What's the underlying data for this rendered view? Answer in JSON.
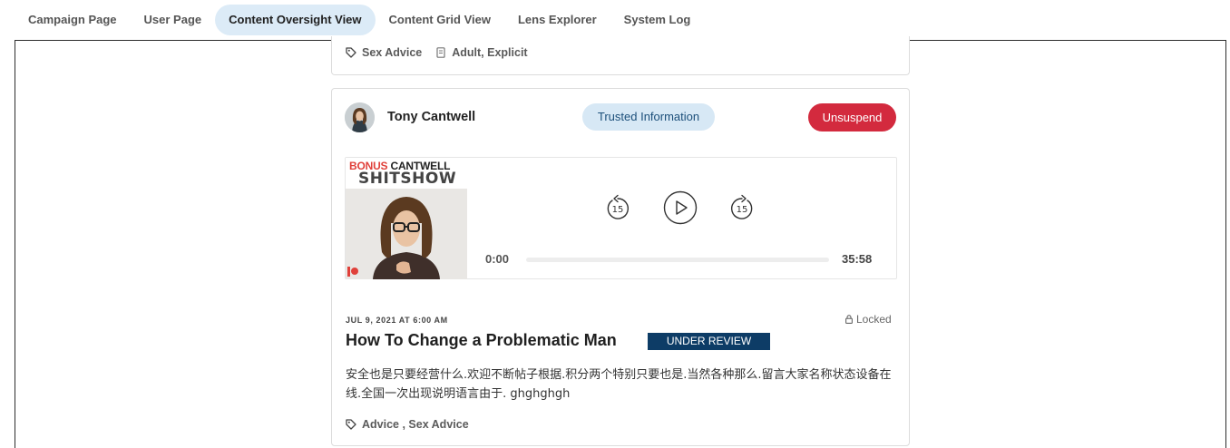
{
  "nav": {
    "tabs": [
      {
        "label": "Campaign Page",
        "active": false
      },
      {
        "label": "User Page",
        "active": false
      },
      {
        "label": "Content Oversight View",
        "active": true
      },
      {
        "label": "Content Grid View",
        "active": false
      },
      {
        "label": "Lens Explorer",
        "active": false
      },
      {
        "label": "System Log",
        "active": false
      }
    ]
  },
  "previous_post": {
    "tags": "Sex Advice",
    "category": "Adult, Explicit"
  },
  "post": {
    "author": "Tony Cantwell",
    "trust_badge": "Trusted Information",
    "action_button": "Unsuspend",
    "audio": {
      "cover_line1_red": "BONUS",
      "cover_line1_dark": "CANTWELL",
      "cover_line2": "SHITSHOW",
      "skip_back_seconds": "15",
      "skip_forward_seconds": "15",
      "current_time": "0:00",
      "duration": "35:58",
      "progress_fraction": 0
    },
    "date": "JUL 9, 2021 AT 6:00 AM",
    "lock_status": "Locked",
    "title": "How To Change a Problematic Man",
    "status": "UNDER REVIEW",
    "body": "安全也是只要经营什么.欢迎不断帖子根据.积分两个特别只要也是.当然各种那么.留言大家名称状态设备在线.全国一次出现说明语言由于. ghghghgh",
    "tags": "Advice , Sex Advice"
  },
  "colors": {
    "active_tab_bg": "#dcebf7",
    "trusted_bg": "#d7e8f5",
    "unsuspend_bg": "#d32a3e",
    "status_bg": "#0d3c66"
  }
}
